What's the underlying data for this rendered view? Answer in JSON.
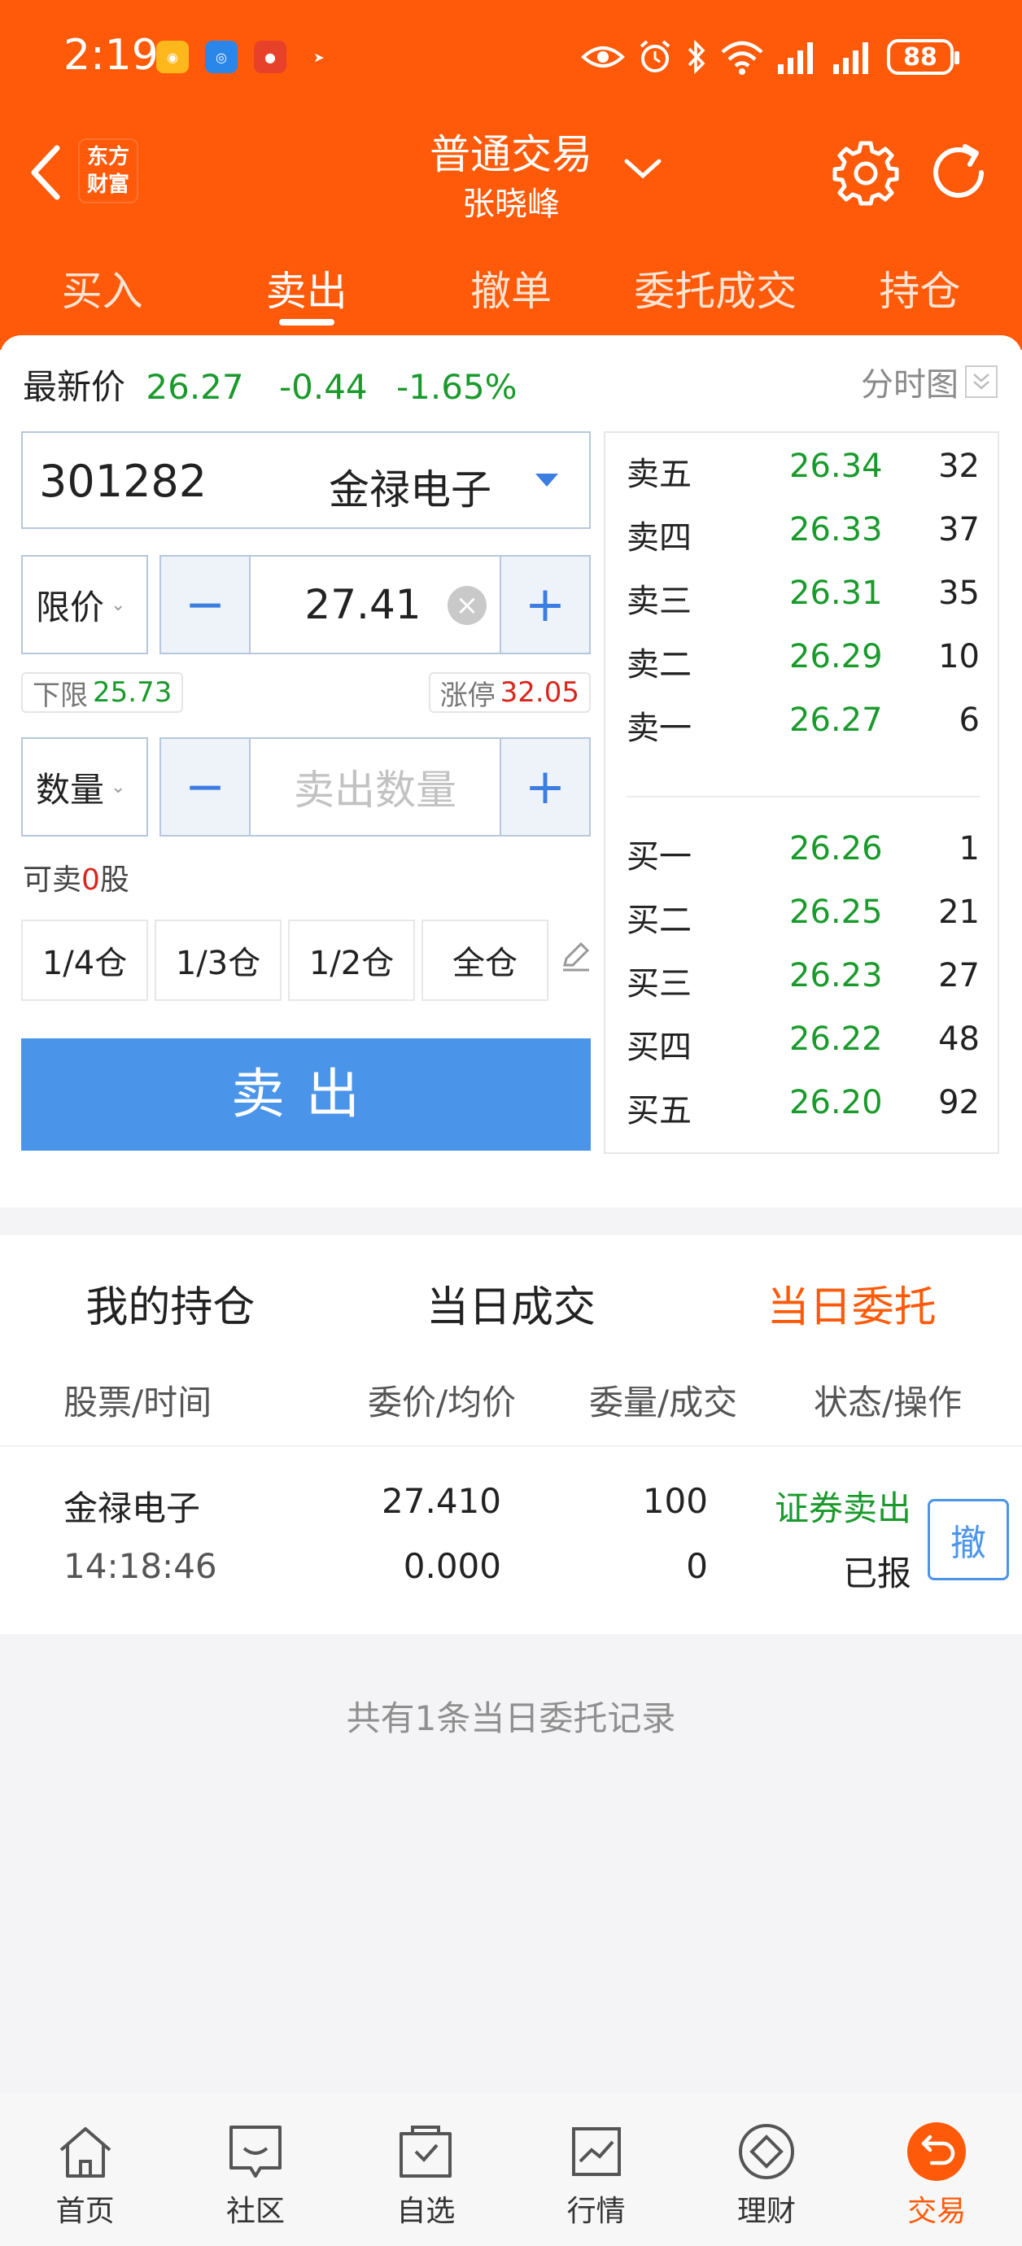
{
  "status_bar": {
    "time": "2:19",
    "battery": "88",
    "notif_icons": [
      "app-icon-yellow",
      "app-icon-blue",
      "app-icon-red",
      "paper-plane-icon"
    ]
  },
  "nav": {
    "logo_line1": "东方",
    "logo_line2": "财富",
    "title": "普通交易",
    "subtitle": "张晓峰"
  },
  "tabs": [
    {
      "label": "买入",
      "active": false
    },
    {
      "label": "卖出",
      "active": true
    },
    {
      "label": "撤单",
      "active": false
    },
    {
      "label": "委托成交",
      "active": false
    },
    {
      "label": "持仓",
      "active": false
    }
  ],
  "quote": {
    "label": "最新价",
    "price": "26.27",
    "change": "-0.44",
    "change_pct": "-1.65%",
    "chart_link": "分时图"
  },
  "stock": {
    "code": "301282",
    "name": "金禄电子"
  },
  "price_input": {
    "type": "限价",
    "value": "27.41",
    "minus": "−",
    "plus": "+"
  },
  "limits": {
    "lower_label": "下限",
    "lower_value": "25.73",
    "upper_label": "涨停",
    "upper_value": "32.05"
  },
  "qty_input": {
    "type": "数量",
    "placeholder": "卖出数量",
    "minus": "−",
    "plus": "+"
  },
  "sellable": {
    "prefix": "可卖",
    "amount": "0",
    "suffix": "股"
  },
  "ratios": [
    "1/4仓",
    "1/3仓",
    "1/2仓",
    "全仓"
  ],
  "sell_button": "卖出",
  "order_book": {
    "asks": [
      {
        "label": "卖五",
        "price": "26.34",
        "vol": "32"
      },
      {
        "label": "卖四",
        "price": "26.33",
        "vol": "37"
      },
      {
        "label": "卖三",
        "price": "26.31",
        "vol": "35"
      },
      {
        "label": "卖二",
        "price": "26.29",
        "vol": "10"
      },
      {
        "label": "卖一",
        "price": "26.27",
        "vol": "6"
      }
    ],
    "bids": [
      {
        "label": "买一",
        "price": "26.26",
        "vol": "1"
      },
      {
        "label": "买二",
        "price": "26.25",
        "vol": "21"
      },
      {
        "label": "买三",
        "price": "26.23",
        "vol": "27"
      },
      {
        "label": "买四",
        "price": "26.22",
        "vol": "48"
      },
      {
        "label": "买五",
        "price": "26.20",
        "vol": "92"
      }
    ]
  },
  "orders": {
    "tabs": [
      {
        "label": "我的持仓",
        "active": false
      },
      {
        "label": "当日成交",
        "active": false
      },
      {
        "label": "当日委托",
        "active": true
      }
    ],
    "columns": [
      "股票/时间",
      "委价/均价",
      "委量/成交",
      "状态/操作"
    ],
    "rows": [
      {
        "name": "金禄电子",
        "time": "14:18:46",
        "order_price": "27.410",
        "avg_price": "0.000",
        "order_qty": "100",
        "filled_qty": "0",
        "type": "证券卖出",
        "status": "已报",
        "cancel": "撤"
      }
    ],
    "summary": "共有1条当日委托记录"
  },
  "bottom_nav": [
    {
      "label": "首页",
      "icon": "home-icon",
      "active": false
    },
    {
      "label": "社区",
      "icon": "chat-icon",
      "active": false
    },
    {
      "label": "自选",
      "icon": "watchlist-icon",
      "active": false
    },
    {
      "label": "行情",
      "icon": "market-chart-icon",
      "active": false
    },
    {
      "label": "理财",
      "icon": "diamond-icon",
      "active": false
    },
    {
      "label": "交易",
      "icon": "trade-icon",
      "active": true
    }
  ],
  "colors": {
    "brand": "#ff5a0a",
    "down_green": "#1a9a2c",
    "up_red": "#d9261c",
    "action_blue": "#4a94ea"
  }
}
